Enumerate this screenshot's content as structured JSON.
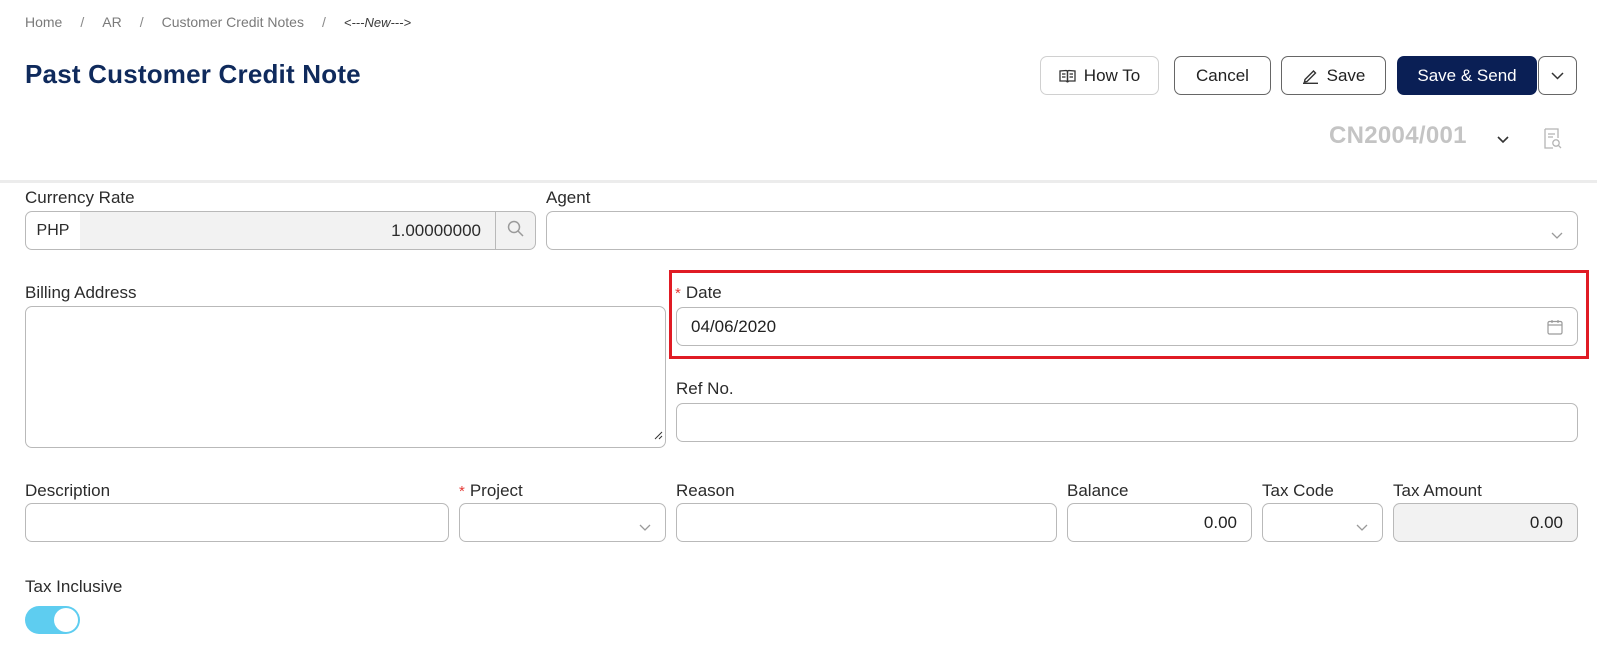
{
  "breadcrumb": {
    "items": [
      "Home",
      "AR",
      "Customer Credit Notes"
    ],
    "current": "<---New--->"
  },
  "page_title": "Past Customer Credit Note",
  "toolbar": {
    "how_to_label": "How To",
    "cancel_label": "Cancel",
    "save_label": "Save",
    "save_send_label": "Save & Send"
  },
  "document_number": "CN2004/001",
  "form": {
    "currency_rate": {
      "label": "Currency Rate",
      "currency": "PHP",
      "rate": "1.00000000"
    },
    "agent": {
      "label": "Agent",
      "value": ""
    },
    "billing_address": {
      "label": "Billing Address",
      "value": ""
    },
    "date": {
      "label": "Date",
      "value": "04/06/2020",
      "required": "*"
    },
    "ref_no": {
      "label": "Ref No.",
      "value": ""
    },
    "description": {
      "label": "Description",
      "value": ""
    },
    "project": {
      "label": "Project",
      "value": "",
      "required": "*"
    },
    "reason": {
      "label": "Reason",
      "value": ""
    },
    "balance": {
      "label": "Balance",
      "value": "0.00"
    },
    "tax_code": {
      "label": "Tax Code",
      "value": ""
    },
    "tax_amount": {
      "label": "Tax Amount",
      "value": "0.00"
    },
    "tax_inclusive": {
      "label": "Tax Inclusive",
      "enabled": true
    }
  },
  "colors": {
    "title": "#0f2a5c",
    "primary_button": "#0a1f55",
    "highlight": "#e01b24",
    "toggle_on": "#5ecdf0",
    "required": "#e53935"
  },
  "icons": [
    "book-icon",
    "pencil-icon",
    "chevron-down-icon",
    "search-icon",
    "calendar-icon",
    "document-preview-icon"
  ]
}
